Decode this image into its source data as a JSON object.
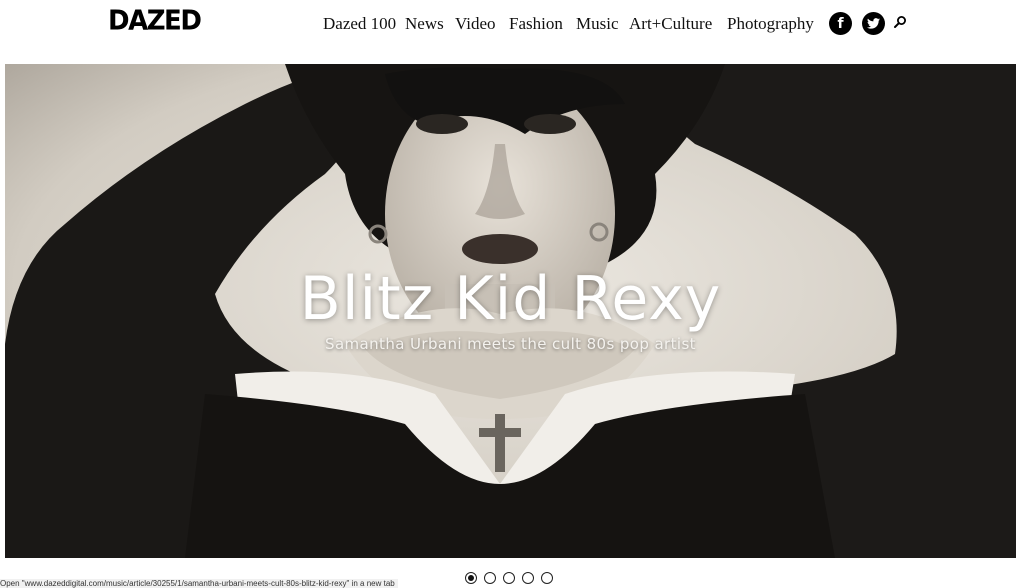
{
  "header": {
    "logo": "DAZED",
    "nav": [
      "Dazed 100",
      "News",
      "Video",
      "Fashion",
      "Music",
      "Art+Culture",
      "Photography"
    ],
    "social": {
      "facebook": "f"
    }
  },
  "hero": {
    "title": "Blitz Kid Rexy",
    "subtitle": "Samantha Urbani meets the cult 80s pop artist",
    "photo_icon": "portrait-photo"
  },
  "status_bar": {
    "url_text": "Open \"www.dazeddigital.com/music/article/30255/1/samantha-urbani-meets-cult-80s-blitz-kid-rexy\" in a new tab"
  },
  "carousel": {
    "count": 5,
    "active_index": 0
  },
  "colors": {
    "text": "#111111",
    "hero_text": "#ffffff",
    "social_bg": "#000000"
  }
}
